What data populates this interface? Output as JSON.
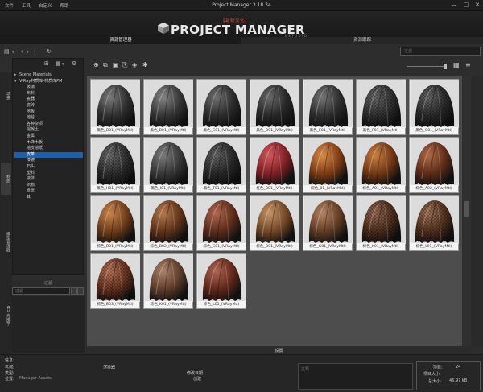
{
  "window": {
    "title": "Project Manager 3.18.34",
    "menu": [
      "文件",
      "工具",
      "自定义",
      "帮助"
    ],
    "controls": [
      "—",
      "□",
      "✕"
    ]
  },
  "banner": {
    "badge": "【最新汉化】",
    "logo_text": "PROJECT MANAGER",
    "sub_text": "KSTUDIO"
  },
  "main_tabs": [
    "资源管理器",
    "资源跟踪"
  ],
  "search": {
    "placeholder": "过滤"
  },
  "side_tabs": [
    "场景",
    "材质",
    "模型管理器",
    "IES 光度学"
  ],
  "tree": {
    "items": [
      {
        "label": "Scene Materials",
        "level": 0,
        "expander": "▸",
        "selected": false
      },
      {
        "label": "V-Ray材质库-材质库PM",
        "level": 0,
        "expander": "▾",
        "selected": false
      },
      {
        "label": "玻璃",
        "level": 1,
        "expander": "",
        "selected": false
      },
      {
        "label": "布料",
        "level": 1,
        "expander": "",
        "selected": false
      },
      {
        "label": "瓷器",
        "level": 1,
        "expander": "",
        "selected": false
      },
      {
        "label": "瓷砖",
        "level": 1,
        "expander": "",
        "selected": false
      },
      {
        "label": "地板",
        "level": 1,
        "expander": "",
        "selected": false
      },
      {
        "label": "地毯",
        "level": 1,
        "expander": "",
        "selected": false
      },
      {
        "label": "各种杂项",
        "level": 1,
        "expander": "",
        "selected": false
      },
      {
        "label": "混凝土",
        "level": 1,
        "expander": "",
        "selected": false
      },
      {
        "label": "金属",
        "level": 1,
        "expander": "",
        "selected": false
      },
      {
        "label": "木饰木板",
        "level": 1,
        "expander": "",
        "selected": false
      },
      {
        "label": "墙皮墙纸",
        "level": 1,
        "expander": "",
        "selected": false
      },
      {
        "label": "皮革",
        "level": 1,
        "expander": "",
        "selected": true
      },
      {
        "label": "漆镜",
        "level": 1,
        "expander": "",
        "selected": false
      },
      {
        "label": "石头",
        "level": 1,
        "expander": "",
        "selected": false
      },
      {
        "label": "塑料",
        "level": 1,
        "expander": "",
        "selected": false
      },
      {
        "label": "液体",
        "level": 1,
        "expander": "",
        "selected": false
      },
      {
        "label": "织物",
        "level": 1,
        "expander": "",
        "selected": false
      },
      {
        "label": "纸张",
        "level": 1,
        "expander": "",
        "selected": false
      },
      {
        "label": "其",
        "level": 1,
        "expander": "",
        "selected": false
      }
    ],
    "footer_label": "过滤",
    "filter_placeholder": "过滤"
  },
  "thumbnails": [
    {
      "label": "黑色_B01_(VRayMtl)",
      "tone": "#2e2e2e",
      "hi": "#7a7a7a",
      "pattern": "smooth"
    },
    {
      "label": "黑色_B01_(VRayMtl)",
      "tone": "#333333",
      "hi": "#858585",
      "pattern": "smooth"
    },
    {
      "label": "黑色_C01_(VRayMtl)",
      "tone": "#2a2a2a",
      "hi": "#707070",
      "pattern": "smooth"
    },
    {
      "label": "黑色_D01_(VRayMtl)",
      "tone": "#262626",
      "hi": "#6a6a6a",
      "pattern": "smooth"
    },
    {
      "label": "黑色_E01_(VRayMtl)",
      "tone": "#2c2c2c",
      "hi": "#747474",
      "pattern": "smooth"
    },
    {
      "label": "黑色_F01_(VRayMtl)",
      "tone": "#303030",
      "hi": "#6e6e6e",
      "pattern": "scales"
    },
    {
      "label": "黑色_G01_(VRayMtl)",
      "tone": "#2b2b2b",
      "hi": "#6c6c6c",
      "pattern": "scales"
    },
    {
      "label": "黑色_H01_(VRayMtl)",
      "tone": "#2f2f2f",
      "hi": "#727272",
      "pattern": "scales"
    },
    {
      "label": "黑色_I01_(VRayMtl)",
      "tone": "#353535",
      "hi": "#7c7c7c",
      "pattern": "smooth"
    },
    {
      "label": "黑色_T01_(VRayMtl)",
      "tone": "#2a2a2a",
      "hi": "#6c6c6c",
      "pattern": "scales"
    },
    {
      "label": "红色_B01_(VRayMtl)",
      "tone": "#7a1f24",
      "hi": "#d25a5e",
      "pattern": "smooth"
    },
    {
      "label": "棕色_01_(VRayMtl)",
      "tone": "#7a3a14",
      "hi": "#d98c4a",
      "pattern": "smooth"
    },
    {
      "label": "棕色_A01_(VRayMtl)",
      "tone": "#6e3413",
      "hi": "#c98043",
      "pattern": "smooth"
    },
    {
      "label": "棕色_A02_(VRayMtl)",
      "tone": "#5a2a18",
      "hi": "#b06a46",
      "pattern": "smooth"
    },
    {
      "label": "棕色_B01_(VRayMtl)",
      "tone": "#6b3a18",
      "hi": "#c8844c",
      "pattern": "smooth"
    },
    {
      "label": "棕色_B02_(VRayMtl)",
      "tone": "#5c3118",
      "hi": "#b47a50",
      "pattern": "smooth"
    },
    {
      "label": "棕色_C01_(VRayMtl)",
      "tone": "#5a2a1a",
      "hi": "#b06650",
      "pattern": "smooth"
    },
    {
      "label": "棕色_D01_(VRayMtl)",
      "tone": "#6e4426",
      "hi": "#c79468",
      "pattern": "smooth"
    },
    {
      "label": "棕色_G01_(VRayMtl)",
      "tone": "#5e3a22",
      "hi": "#b68464",
      "pattern": "smooth"
    },
    {
      "label": "棕色_K01_(VRayMtl)",
      "tone": "#4e2e1c",
      "hi": "#9e7058",
      "pattern": "scales"
    },
    {
      "label": "棕色_L01_(VRayMtl)",
      "tone": "#54321e",
      "hi": "#a8785c",
      "pattern": "scales"
    },
    {
      "label": "棕色_B03_(VRayMtl)",
      "tone": "#6a3320",
      "hi": "#c27a5c",
      "pattern": "scales"
    },
    {
      "label": "棕色_K01_(VRayMtl)",
      "tone": "#5a3a28",
      "hi": "#aa846c",
      "pattern": "smooth"
    },
    {
      "label": "棕色_L01_(VRayMtl)",
      "tone": "#5c2618",
      "hi": "#b06454",
      "pattern": "smooth"
    }
  ],
  "settings_label": "设置",
  "info": {
    "title": "信息:",
    "name_label": "名称:",
    "type_label": "类型:",
    "path_label": "位置:",
    "path_value": "Manager Assets",
    "renderer_label": "渲染器",
    "modified_label": "修改日期",
    "size_label": "创建",
    "note_placeholder": "注释",
    "count_label": "项目:",
    "count_value": "24",
    "selected_label": "项目大小:",
    "total_label": "总大小:",
    "total_value": "46.97 kB"
  }
}
